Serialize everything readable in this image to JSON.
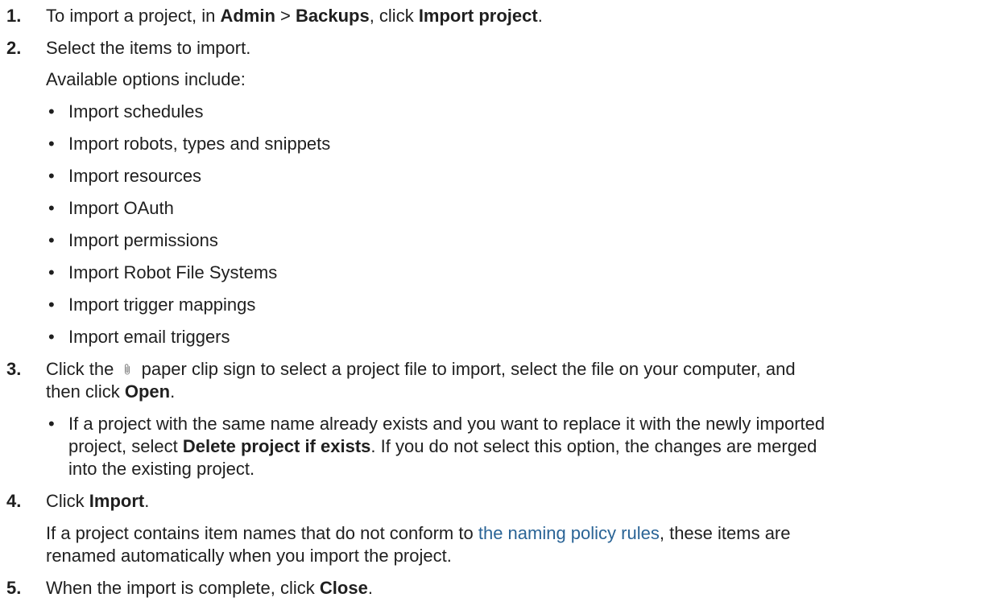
{
  "steps": [
    {
      "number": "1.",
      "parts": {
        "a": "To import a project, in ",
        "b": "Admin",
        "c": " > ",
        "d": "Backups",
        "e": ", click ",
        "f": "Import project",
        "g": "."
      }
    },
    {
      "number": "2.",
      "text": "Select the items to import.",
      "intro": "Available options include:",
      "options": [
        "Import schedules",
        "Import robots, types and snippets",
        "Import resources",
        "Import OAuth",
        "Import permissions",
        "Import Robot File Systems",
        "Import trigger mappings",
        "Import email triggers"
      ]
    },
    {
      "number": "3.",
      "parts": {
        "a": "Click the ",
        "icon": "paperclip-icon",
        "b": " paper clip sign to select a project file to import, select the file on your computer, and",
        "c": "then click ",
        "d": "Open",
        "e": "."
      },
      "note": {
        "a": "If a project with the same name already exists and you want to replace it with the newly imported",
        "b": "project, select ",
        "c": "Delete project if exists",
        "d": ". If you do not select this option, the changes are merged",
        "e": "into the existing project."
      }
    },
    {
      "number": "4.",
      "parts": {
        "a": "Click ",
        "b": "Import",
        "c": "."
      },
      "info": {
        "a": "If a project contains item names that do not conform to ",
        "link": "the naming policy rules",
        "b": ", these items are",
        "c": "renamed automatically when you import the project."
      }
    },
    {
      "number": "5.",
      "parts": {
        "a": "When the import is complete, click ",
        "b": "Close",
        "c": "."
      }
    }
  ]
}
